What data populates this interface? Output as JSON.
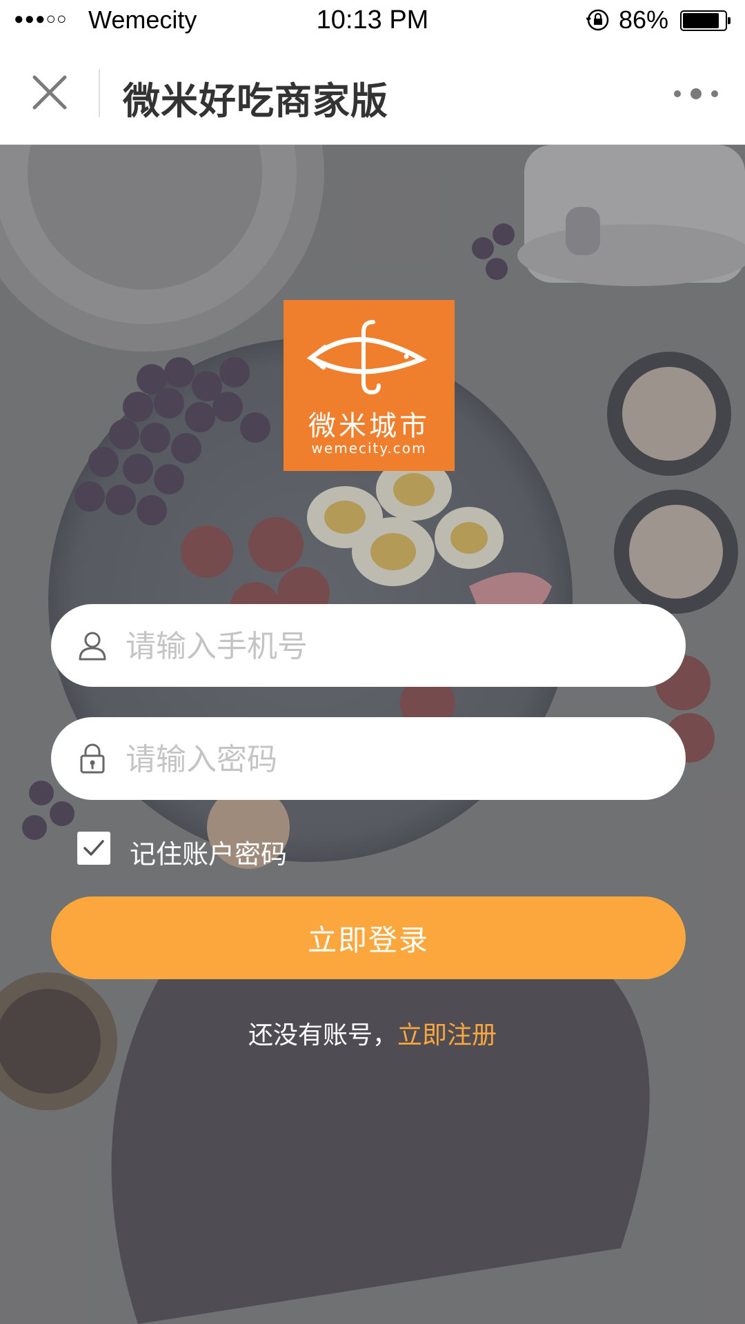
{
  "status_bar": {
    "signal": "●●●○○",
    "carrier": "Wemecity",
    "time": "10:13 PM",
    "battery_percent": "86%",
    "battery_level": 0.86,
    "rotation_lock_icon": "rotation-lock-icon"
  },
  "nav": {
    "title": "微米好吃商家版",
    "close_icon": "close-icon",
    "more_icon": "more-dots-icon"
  },
  "logo": {
    "brand_cn": "微米城市",
    "brand_en": "wemecity.com",
    "color": "#f07f2d"
  },
  "form": {
    "phone": {
      "placeholder": "请输入手机号",
      "value": "",
      "icon": "user-icon"
    },
    "password": {
      "placeholder": "请输入密码",
      "value": "",
      "icon": "lock-icon"
    },
    "remember": {
      "label": "记住账户密码",
      "checked": true
    },
    "login_label": "立即登录"
  },
  "register": {
    "prompt": "还没有账号，",
    "link": "立即注册"
  },
  "colors": {
    "accent": "#fba73d",
    "brand": "#f07f2d"
  }
}
